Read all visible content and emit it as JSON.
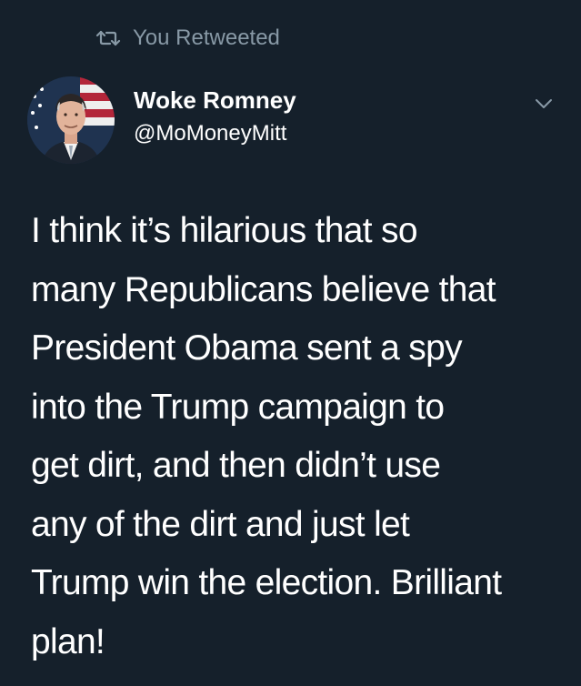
{
  "retweet": {
    "label": "You Retweeted",
    "icon": "retweet-icon"
  },
  "author": {
    "display_name": "Woke Romney",
    "handle": "@MoMoneyMitt",
    "avatar": "avatar"
  },
  "menu": {
    "icon": "chevron-down-icon"
  },
  "tweet": {
    "text": "I think it’s hilarious that so\nmany Republicans believe that\nPresident Obama sent a spy\ninto the Trump campaign to\nget dirt, and then didn’t use\nany of the dirt and just let\nTrump win the election. Brilliant\nplan!"
  },
  "colors": {
    "background": "#15202b",
    "secondary_text": "#8899a6",
    "primary_text": "#ffffff"
  }
}
